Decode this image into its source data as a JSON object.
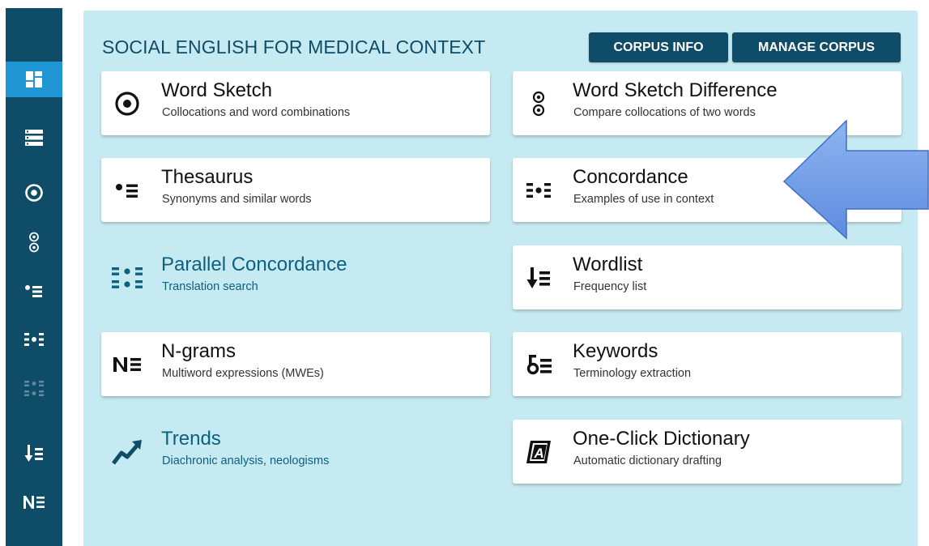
{
  "sidebar": {
    "items": [
      {
        "icon": "dashboard-icon",
        "state": "active"
      },
      {
        "icon": "corpus-list-icon",
        "state": "normal"
      },
      {
        "icon": "word-sketch-icon",
        "state": "normal"
      },
      {
        "icon": "word-sketch-difference-icon",
        "state": "normal"
      },
      {
        "icon": "thesaurus-icon",
        "state": "normal"
      },
      {
        "icon": "concordance-icon",
        "state": "normal"
      },
      {
        "icon": "parallel-concordance-icon",
        "state": "disabled"
      },
      {
        "icon": "wordlist-icon",
        "state": "normal"
      },
      {
        "icon": "ngrams-icon",
        "state": "normal"
      }
    ]
  },
  "header": {
    "title": "SOCIAL ENGLISH FOR MEDICAL CONTEXT",
    "corpus_info_label": "CORPUS INFO",
    "manage_corpus_label": "MANAGE CORPUS"
  },
  "tools": [
    {
      "title": "Word Sketch",
      "subtitle": "Collocations and word combinations",
      "icon": "word-sketch-icon",
      "enabled": true
    },
    {
      "title": "Word Sketch Difference",
      "subtitle": "Compare collocations of two words",
      "icon": "word-sketch-difference-icon",
      "enabled": true
    },
    {
      "title": "Thesaurus",
      "subtitle": "Synonyms and similar words",
      "icon": "thesaurus-icon",
      "enabled": true
    },
    {
      "title": "Concordance",
      "subtitle": "Examples of use in context",
      "icon": "concordance-icon",
      "enabled": true
    },
    {
      "title": "Parallel Concordance",
      "subtitle": "Translation search",
      "icon": "parallel-concordance-icon",
      "enabled": false
    },
    {
      "title": "Wordlist",
      "subtitle": "Frequency list",
      "icon": "wordlist-icon",
      "enabled": true
    },
    {
      "title": "N-grams",
      "subtitle": "Multiword expressions (MWEs)",
      "icon": "ngrams-icon",
      "enabled": true
    },
    {
      "title": "Keywords",
      "subtitle": "Terminology extraction",
      "icon": "keywords-icon",
      "enabled": true
    },
    {
      "title": "Trends",
      "subtitle": "Diachronic analysis, neologisms",
      "icon": "trends-icon",
      "enabled": false
    },
    {
      "title": "One-Click Dictionary",
      "subtitle": "Automatic dictionary drafting",
      "icon": "one-click-dictionary-icon",
      "enabled": true
    }
  ],
  "colors": {
    "sidebar": "#0e4c67",
    "sidebar_active": "#2196d4",
    "panel": "#c6eaf2",
    "header_button": "#0e4c67",
    "arrow_fill": "#6e9be6",
    "arrow_stroke": "#3f6fc4"
  }
}
